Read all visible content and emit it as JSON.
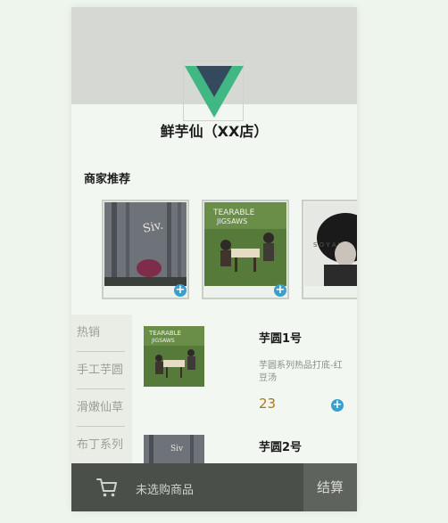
{
  "shop": {
    "title": "鲜芋仙（XX店）"
  },
  "recommend": {
    "title": "商家推荐"
  },
  "sidebar": {
    "items": [
      {
        "label": "热销"
      },
      {
        "label": "手工芋圆"
      },
      {
        "label": "滑嫩仙草"
      },
      {
        "label": "布丁系列"
      }
    ]
  },
  "goods": [
    {
      "name": "芋圆1号",
      "desc": "芋圆系列热品打底-红豆汤",
      "price": "23"
    },
    {
      "name": "芋圆2号"
    }
  ],
  "cart": {
    "empty_label": "未选购商品",
    "checkout_label": "结算"
  },
  "icons": {
    "add": "plus-icon",
    "cart": "cart-icon"
  },
  "colors": {
    "accent": "#3a9fcf",
    "price": "#a77a1e",
    "cart_bar": "#4b4f49"
  }
}
